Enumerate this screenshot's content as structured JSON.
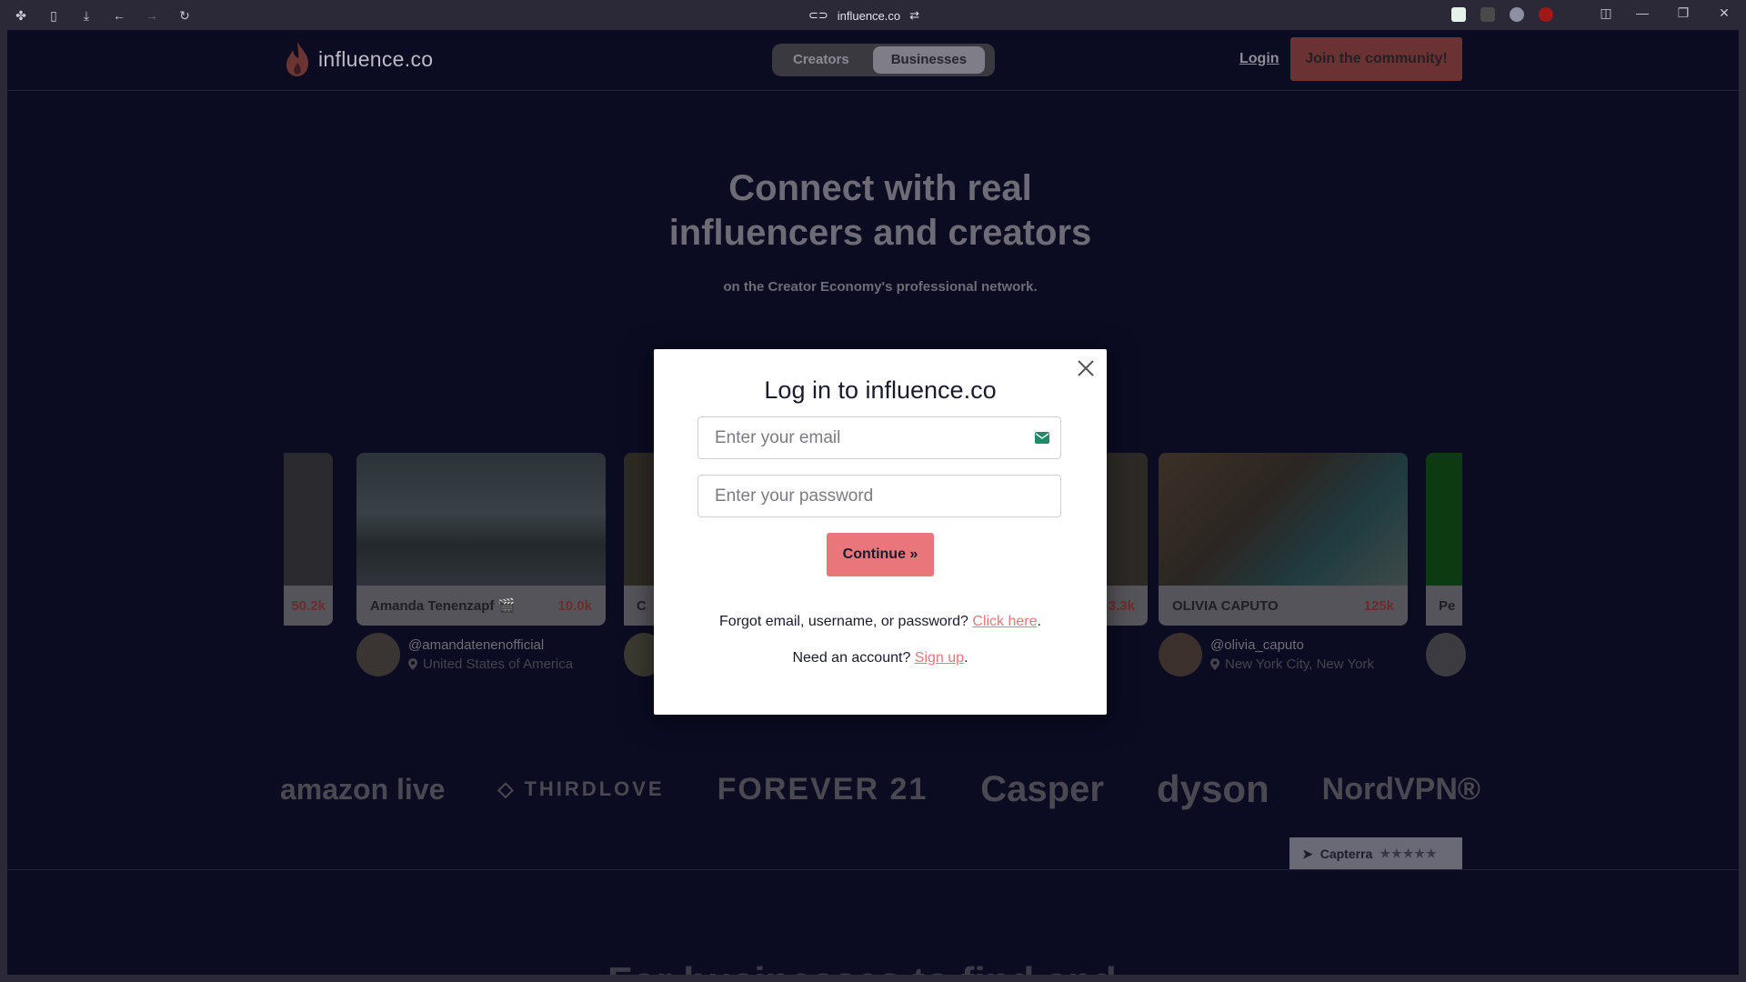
{
  "browser": {
    "url": "influence.co"
  },
  "nav": {
    "brand": "influence.co",
    "segments": [
      {
        "label": "Creators",
        "active": false
      },
      {
        "label": "Businesses",
        "active": true
      }
    ],
    "login": "Login",
    "join": "Join the community!"
  },
  "hero": {
    "title_line1": "Connect with real",
    "title_line2": "influencers and creators",
    "subtitle": "on the Creator Economy's professional network."
  },
  "cards": [
    {
      "name": "Amanda Tenenzapf 🎬",
      "count": "10.0k",
      "handle": "@amandatenenofficial",
      "location": "United States of America"
    },
    {
      "name": "OLIVIA CAPUTO",
      "count": "125k",
      "handle": "@olivia_caputo",
      "location": "New York City, New York"
    }
  ],
  "partial_cards": {
    "left_count": "50.2k",
    "mid_letter": "C",
    "right_count": "3.3k",
    "far_right": "Pe"
  },
  "brands": [
    "amazon live",
    "THIRDLOVE",
    "FOREVER 21",
    "Casper",
    "dyson",
    "NordVPN®"
  ],
  "capterra": {
    "label": "Capterra",
    "stars": "★★★★★"
  },
  "bottom_text": "For businesses to find and",
  "modal": {
    "title": "Log in to influence.co",
    "email_placeholder": "Enter your email",
    "password_placeholder": "Enter your password",
    "continue": "Continue »",
    "forgot_text": "Forgot email, username, or password? ",
    "forgot_link": "Click here",
    "signup_text": "Need an account? ",
    "signup_link": "Sign up"
  },
  "colors": {
    "page_bg": "#0b0b22",
    "accent": "#e8767a",
    "modal_bg": "#ffffff"
  }
}
